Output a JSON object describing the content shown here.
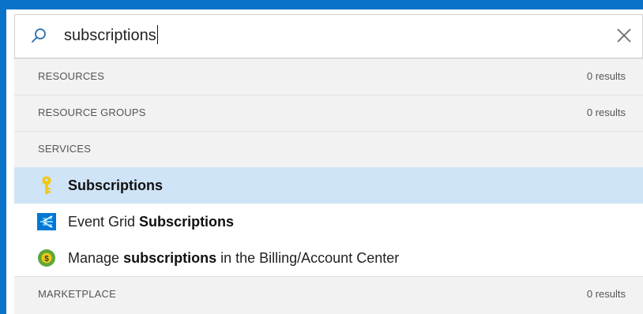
{
  "search": {
    "query": "subscriptions",
    "icon": "search-icon",
    "clear_icon": "close-icon"
  },
  "sections": {
    "resources": {
      "label": "RESOURCES",
      "count": "0 results"
    },
    "resource_groups": {
      "label": "RESOURCE GROUPS",
      "count": "0 results"
    },
    "services": {
      "label": "SERVICES"
    },
    "marketplace": {
      "label": "MARKETPLACE",
      "count": "0 results"
    }
  },
  "services": [
    {
      "icon": "key-icon",
      "parts": [
        {
          "text": "Subscriptions",
          "bold": true
        }
      ]
    },
    {
      "icon": "event-grid-icon",
      "parts": [
        {
          "text": "Event Grid ",
          "bold": false
        },
        {
          "text": "Subscriptions",
          "bold": true
        }
      ]
    },
    {
      "icon": "billing-icon",
      "parts": [
        {
          "text": "Manage ",
          "bold": false
        },
        {
          "text": "subscriptions",
          "bold": true
        },
        {
          "text": " in the Billing/Account Center",
          "bold": false
        }
      ]
    }
  ],
  "colors": {
    "header_blue": "#0a72c9",
    "selected_row": "#cfe4f6"
  }
}
